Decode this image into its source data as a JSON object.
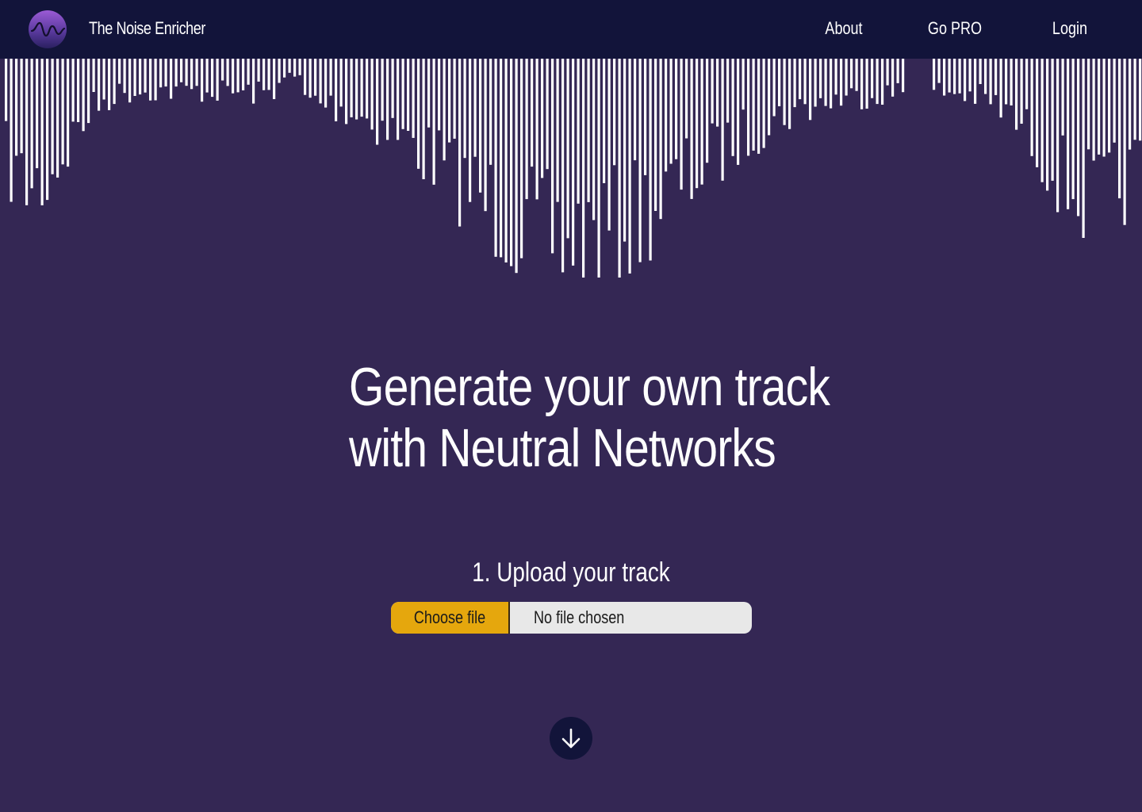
{
  "nav": {
    "brand": "The Noise Enricher",
    "links": [
      {
        "label": "About"
      },
      {
        "label": "Go PRO"
      },
      {
        "label": "Login"
      }
    ]
  },
  "hero": {
    "title_line1": "Generate your own track",
    "title_line2": "with Neutral Networks"
  },
  "upload": {
    "step_label": "1.  Upload your track",
    "choose_button": "Choose file",
    "file_status": "No file chosen"
  },
  "colors": {
    "background": "#342754",
    "navbar": "#12143a",
    "bars": "#ffffff",
    "accent": "#e5a70d"
  },
  "icons": {
    "logo": "waveform-logo-icon",
    "scroll": "arrow-down-icon"
  }
}
